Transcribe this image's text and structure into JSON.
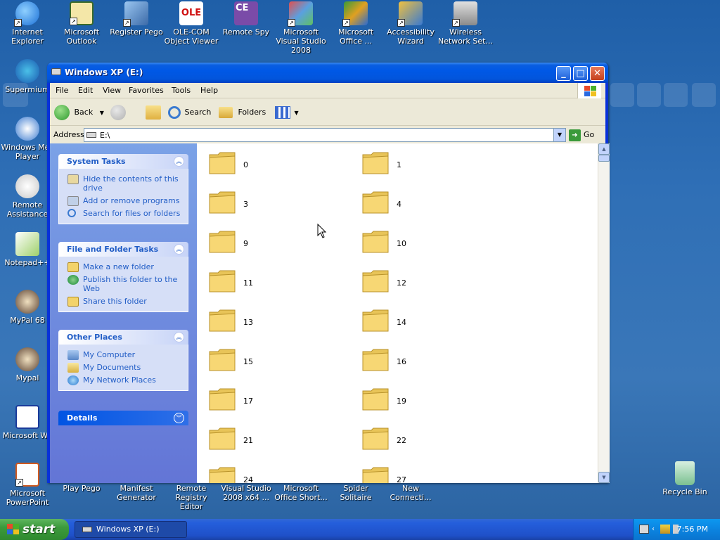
{
  "desktop": {
    "top_icons": [
      {
        "label": "Internet Explorer"
      },
      {
        "label": "Microsoft Outlook"
      },
      {
        "label": "Register Pego"
      },
      {
        "label": "OLE-COM Object Viewer"
      },
      {
        "label": "Remote Spy"
      },
      {
        "label": "Microsoft Visual Studio 2008"
      },
      {
        "label": "Microsoft Office ..."
      },
      {
        "label": "Accessibility Wizard"
      },
      {
        "label": "Wireless Network Set..."
      }
    ],
    "left_icons": [
      {
        "label": "Supermium"
      },
      {
        "label": "Windows Mec Player"
      },
      {
        "label": "Remote Assistance"
      },
      {
        "label": "Notepad++"
      },
      {
        "label": "MyPal 68"
      },
      {
        "label": "Mypal"
      },
      {
        "label": "Microsoft Wo"
      }
    ],
    "bottom_icons": [
      {
        "label": "Microsoft PowerPoint"
      },
      {
        "label": "Play Pego"
      },
      {
        "label": "Manifest Generator"
      },
      {
        "label": "Remote Registry Editor"
      },
      {
        "label": "Visual Studio 2008 x64 ..."
      },
      {
        "label": "Microsoft Office Short..."
      },
      {
        "label": "Spider Solitaire"
      },
      {
        "label": "New Connecti..."
      }
    ],
    "recycle_bin": "Recycle Bin",
    "ole_badge": "OLE",
    "ce_badge": "CE"
  },
  "window": {
    "title": "Windows XP (E:)",
    "minimize": "_",
    "maximize": "□",
    "close": "✕",
    "menu": [
      "File",
      "Edit",
      "View",
      "Favorites",
      "Tools",
      "Help"
    ],
    "toolbar": {
      "back": "Back",
      "search": "Search",
      "folders": "Folders"
    },
    "address": {
      "label": "Address",
      "value": "E:\\",
      "go": "Go"
    }
  },
  "tasks": {
    "system": {
      "title": "System Tasks",
      "items": [
        "Hide the contents of this drive",
        "Add or remove programs",
        "Search for files or folders"
      ]
    },
    "file_folder": {
      "title": "File and Folder Tasks",
      "items": [
        "Make a new folder",
        "Publish this folder to the Web",
        "Share this folder"
      ]
    },
    "other_places": {
      "title": "Other Places",
      "items": [
        "My Computer",
        "My Documents",
        "My Network Places"
      ]
    },
    "details": {
      "title": "Details"
    }
  },
  "folders": [
    "0",
    "1",
    "3",
    "4",
    "9",
    "10",
    "11",
    "12",
    "13",
    "14",
    "15",
    "16",
    "17",
    "19",
    "21",
    "22",
    "24",
    "27"
  ],
  "taskbar": {
    "start": "start",
    "task_window": "Windows XP (E:)",
    "clock": "7:56 PM"
  },
  "colors": {
    "link_blue": "#215dc6",
    "title_blue": "#0058e6",
    "folder_yellow": "#f7d774"
  },
  "icons": {
    "folder": "folder-icon",
    "back": "back-arrow-icon",
    "forward": "forward-arrow-icon",
    "up": "folder-up-icon",
    "search": "magnifier-icon",
    "folders": "folders-icon",
    "views": "views-icon"
  }
}
